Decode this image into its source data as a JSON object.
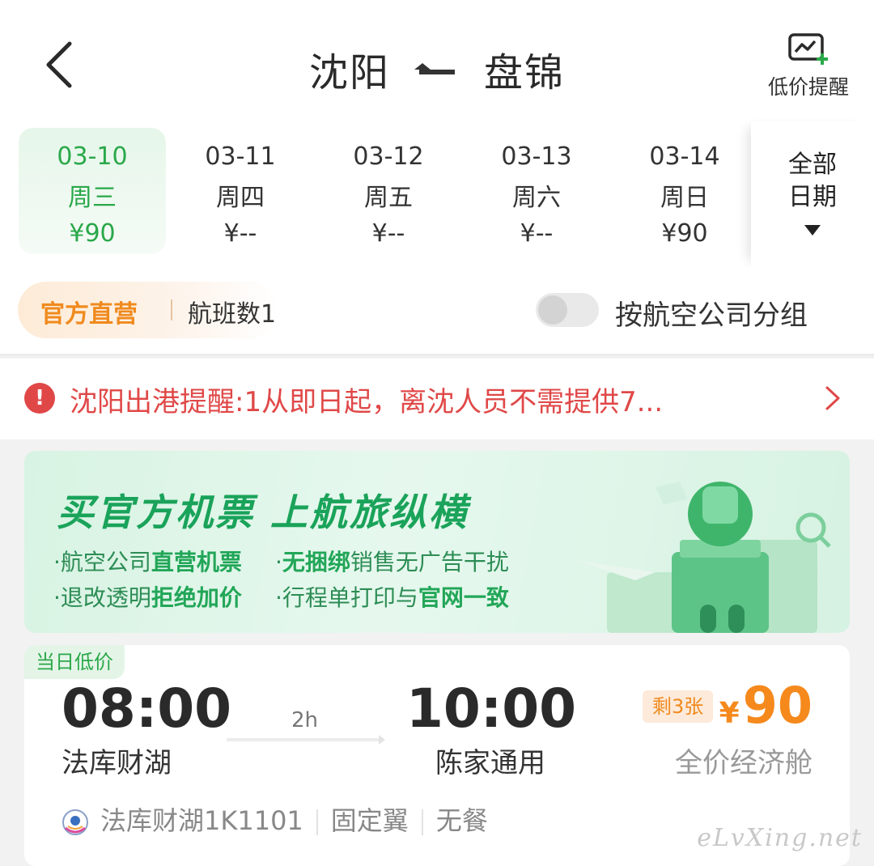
{
  "header": {
    "origin": "沈阳",
    "destination": "盘锦",
    "alert_label": "低价提醒",
    "icons": {
      "back": "back-chevron-icon",
      "alert": "price-chart-plus-icon"
    }
  },
  "dates": [
    {
      "date": "03-10",
      "weekday": "周三",
      "price": "¥90",
      "selected": true
    },
    {
      "date": "03-11",
      "weekday": "周四",
      "price": "¥--",
      "selected": false
    },
    {
      "date": "03-12",
      "weekday": "周五",
      "price": "¥--",
      "selected": false
    },
    {
      "date": "03-13",
      "weekday": "周六",
      "price": "¥--",
      "selected": false
    },
    {
      "date": "03-14",
      "weekday": "周日",
      "price": "¥90",
      "selected": false
    }
  ],
  "all_dates": {
    "line1": "全部",
    "line2": "日期"
  },
  "filter": {
    "official_label": "官方直营",
    "flight_count": "航班数1",
    "group_toggle_label": "按航空公司分组",
    "group_toggle_on": false
  },
  "notice": {
    "text": "沈阳出港提醒:1从即日起，离沈人员不需提供7..."
  },
  "banner": {
    "title": "买官方机票 上航旅纵横",
    "features": [
      {
        "pre": "·航空公司",
        "bold": "直营机票",
        "post": ""
      },
      {
        "pre": "·",
        "bold": "无捆绑",
        "post": "销售无广告干扰"
      },
      {
        "pre": "·退改透明",
        "bold": "拒绝加价",
        "post": ""
      },
      {
        "pre": "·行程单打印与",
        "bold": "官网一致",
        "post": ""
      }
    ]
  },
  "flight": {
    "tag": "当日低价",
    "dep_time": "08:00",
    "arr_time": "10:00",
    "duration": "2h",
    "dep_airport": "法库财湖",
    "arr_airport": "陈家通用",
    "seats_left": "剩3张",
    "currency": "¥",
    "price": "90",
    "cabin": "全价经济舱",
    "flight_no": "法库财湖1K1101",
    "aircraft": "固定翼",
    "meal": "无餐"
  },
  "watermark": "eLvXing.net",
  "colors": {
    "accent_green": "#2aa84a",
    "orange": "#f5891c",
    "alert_red": "#e04848"
  }
}
